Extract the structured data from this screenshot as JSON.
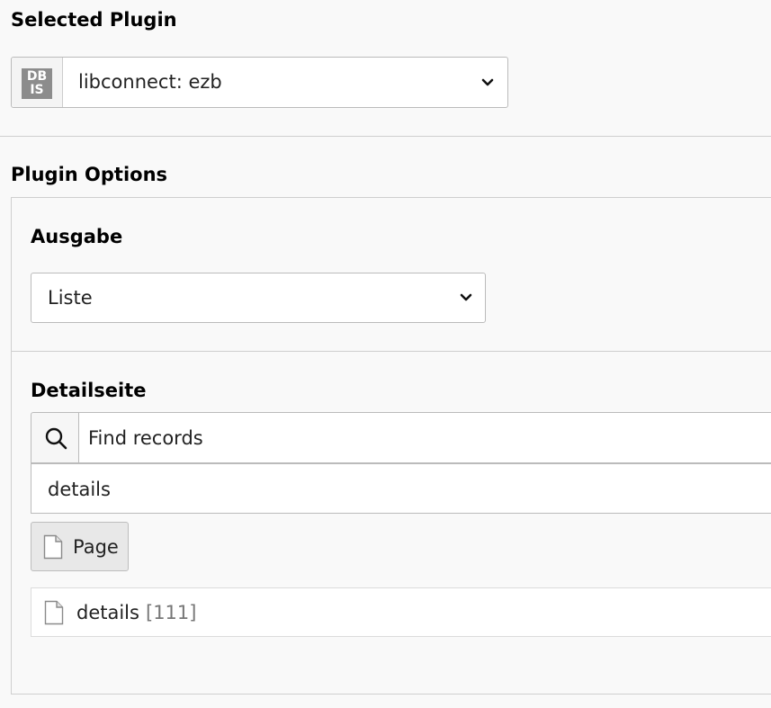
{
  "selected_plugin": {
    "title": "Selected Plugin",
    "icon_text_top": "DB",
    "icon_text_bottom": "IS",
    "value": "libconnect: ezb"
  },
  "plugin_options": {
    "title": "Plugin Options",
    "ausgabe": {
      "label": "Ausgabe",
      "value": "Liste"
    },
    "detailseite": {
      "label": "Detailseite",
      "search_placeholder": "Find records",
      "search_value": "details",
      "page_button_label": "Page",
      "record": {
        "name": "details",
        "id": "[111]"
      }
    }
  },
  "icons": {
    "plugin": "dbis-icon",
    "chevron": "chevron-down-icon",
    "search": "search-icon",
    "page": "page-icon"
  }
}
